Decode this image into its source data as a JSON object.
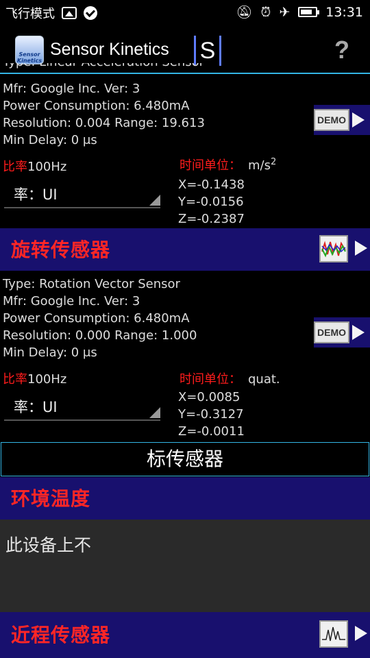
{
  "status_bar": {
    "mode_text": "飞行模式",
    "time": "13:31",
    "icons": [
      "image-icon",
      "check-circle-icon",
      "muted-bell-icon",
      "alarm-icon",
      "airplane-icon",
      "battery-icon"
    ]
  },
  "app_bar": {
    "logo_text": "Sensor Kinetics",
    "title": "Sensor Kinetics",
    "mark": "S",
    "help": "?"
  },
  "linear_accel": {
    "partial_type_line": "Type: Linear Acceleration Sensor",
    "mfr": "Mfr: Google Inc.  Ver: 3",
    "power": "Power Consumption: 6.480mA",
    "resolution": "Resolution: 0.004 Range: 19.613",
    "min_delay": "Min Delay: 0 μs",
    "demo": "DEMO",
    "rate_label": "比率",
    "rate_value": "100Hz",
    "units_label": "时间单位：",
    "units_value": "m/s",
    "units_sup": "2",
    "spinner": "率：UI",
    "x": "X=-0.1438",
    "y": "Y=-0.0156",
    "z": "Z=-0.2387"
  },
  "rotation": {
    "header": "旋转传感器",
    "type": "Type: Rotation Vector Sensor",
    "mfr": "Mfr: Google Inc.  Ver: 3",
    "power": "Power Consumption: 6.480mA",
    "resolution": "Resolution: 0.000 Range: 1.000",
    "min_delay": "Min Delay: 0 μs",
    "demo": "DEMO",
    "rate_label": "比率",
    "rate_value": "100Hz",
    "units_label": "时间单位：",
    "units_value": "quat.",
    "spinner": "率：UI",
    "x": "X=0.0085",
    "y": "Y=-0.3127",
    "z": "Z=-0.0011"
  },
  "standard_header": "标传感器",
  "ambient_temp": {
    "header": "环境温度",
    "message": "此设备上不"
  },
  "proximity": {
    "header": "近程传感器"
  },
  "colors": {
    "header_bg": "#18106e",
    "header_text": "#ff2626",
    "accent": "#33b5e5"
  }
}
